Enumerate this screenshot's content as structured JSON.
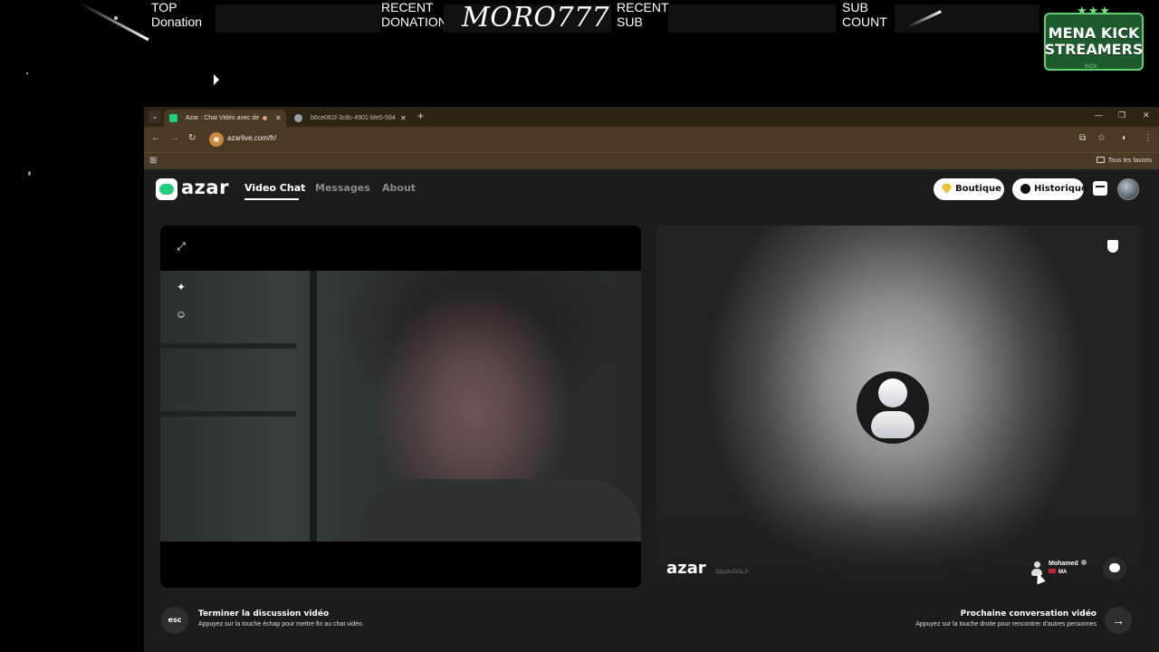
{
  "overlay": {
    "top_donation_label_line1": "TOP",
    "top_donation_label_line2": "Donation",
    "recent_donation_label_line1": "RECENT",
    "recent_donation_label_line2": "DONATION",
    "recent_donation_name": "MORO777",
    "recent_sub_label_line1": "RECENT",
    "recent_sub_label_line2": "SUB",
    "sub_count_label_line1": "SUB",
    "sub_count_label_line2": "COUNT",
    "logo_line1": "MENA KICK",
    "logo_line2": "STREAMERS",
    "logo_stars": "★★★",
    "logo_sub": "KICK"
  },
  "browser": {
    "tabs": [
      {
        "title": "Azar : Chat Vidéo avec de",
        "favicon_color": "#1fd07a"
      },
      {
        "title": "b6ce061f-3c8c-4901-bfe5-594",
        "favicon_color": "#9aa0a6"
      }
    ],
    "url": "azarlive.com/fr/",
    "bookmarks_all": "Tous les favoris"
  },
  "azar": {
    "logo_text": "azar",
    "nav": [
      "Video Chat",
      "Messages",
      "About"
    ],
    "boutique_label": "Boutique",
    "historique_label": "Historique",
    "remote_code": "Gkp9vDGL3-",
    "partner_name": "Mohamed",
    "partner_country": "MA",
    "end_key": "esc",
    "end_title": "Terminer la discussion vidéo",
    "end_subtitle": "Appuyez sur la touche échap pour mettre fin au chat vidéo.",
    "next_title": "Prochaine conversation vidéo",
    "next_subtitle": "Appuyez sur la touche droite pour rencontrer d'autres personnes"
  },
  "colors": {
    "accent_green": "#1fd07a",
    "browser_frame": "#4a3a24",
    "page_bg": "#1c1c1c"
  }
}
